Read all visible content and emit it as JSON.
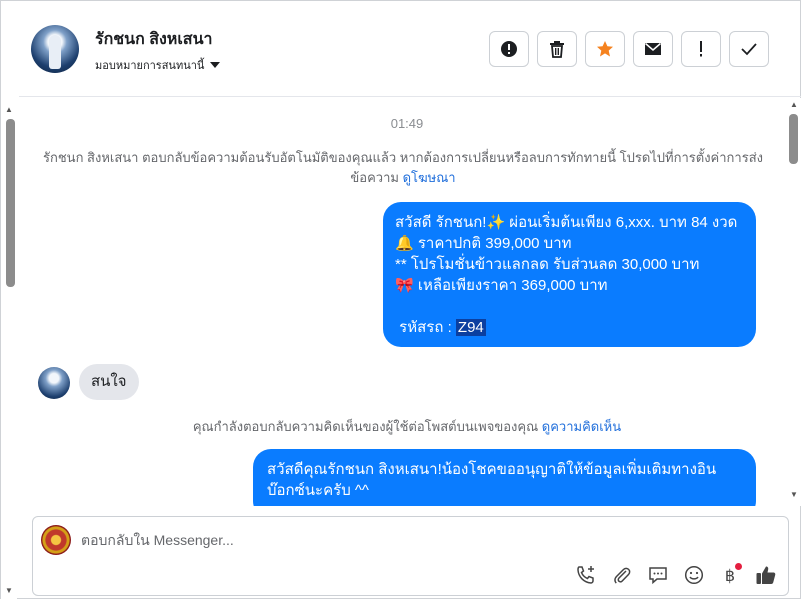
{
  "header": {
    "contact_name": "รักชนก สิงหเสนา",
    "assign_label": "มอบหมายการสนทนานี้"
  },
  "chat": {
    "timestamp": "01:49",
    "auto_reply_notice": "รักชนก สิงหเสนา ตอบกลับข้อความต้อนรับอัตโนมัติของคุณแล้ว หากต้องการเปลี่ยนหรือลบการทักทายนี้ โปรดไปที่การตั้งค่าการส่งข้อความ",
    "auto_reply_link": "ดูโฆษณา",
    "outgoing_1": {
      "line1": "สวัสดี รักชนก!✨  ผ่อนเริ่มต้นเพียง 6,xxx. บาท 84 งวด",
      "line2": "🔔 ราคาปกติ 399,000 บาท",
      "line3": "** โปรโมชั่นข้าวแลกลด รับส่วนลด 30,000 บาท",
      "line4": "🎀  เหลือเพียงราคา 369,000 บาท",
      "line5_prefix": " รหัสรถ : ",
      "line5_code": "Z94"
    },
    "incoming_1": "สนใจ",
    "comment_notice": "คุณกำลังตอบกลับความคิดเห็นของผู้ใช้ต่อโพสต์บนเพจของคุณ",
    "comment_link": "ดูความคิดเห็น",
    "outgoing_2": "สวัสดีคุณรักชนก สิงหเสนา!น้องโชคขออนุญาติให้ข้อมูลเพิ่มเติมทางอินบ๊อกซ์นะครับ ^^"
  },
  "composer": {
    "placeholder": "ตอบกลับใน Messenger...",
    "baht_symbol": "฿"
  },
  "icons": {
    "spam": "alert-circle-icon",
    "delete": "trash-icon",
    "star": "star-icon",
    "mail": "envelope-icon",
    "important": "exclamation-icon",
    "done": "check-icon"
  },
  "colors": {
    "outgoing_bubble": "#0a7cff",
    "incoming_bubble": "#e4e6eb",
    "star": "#f5821f",
    "link": "#216fdb"
  }
}
